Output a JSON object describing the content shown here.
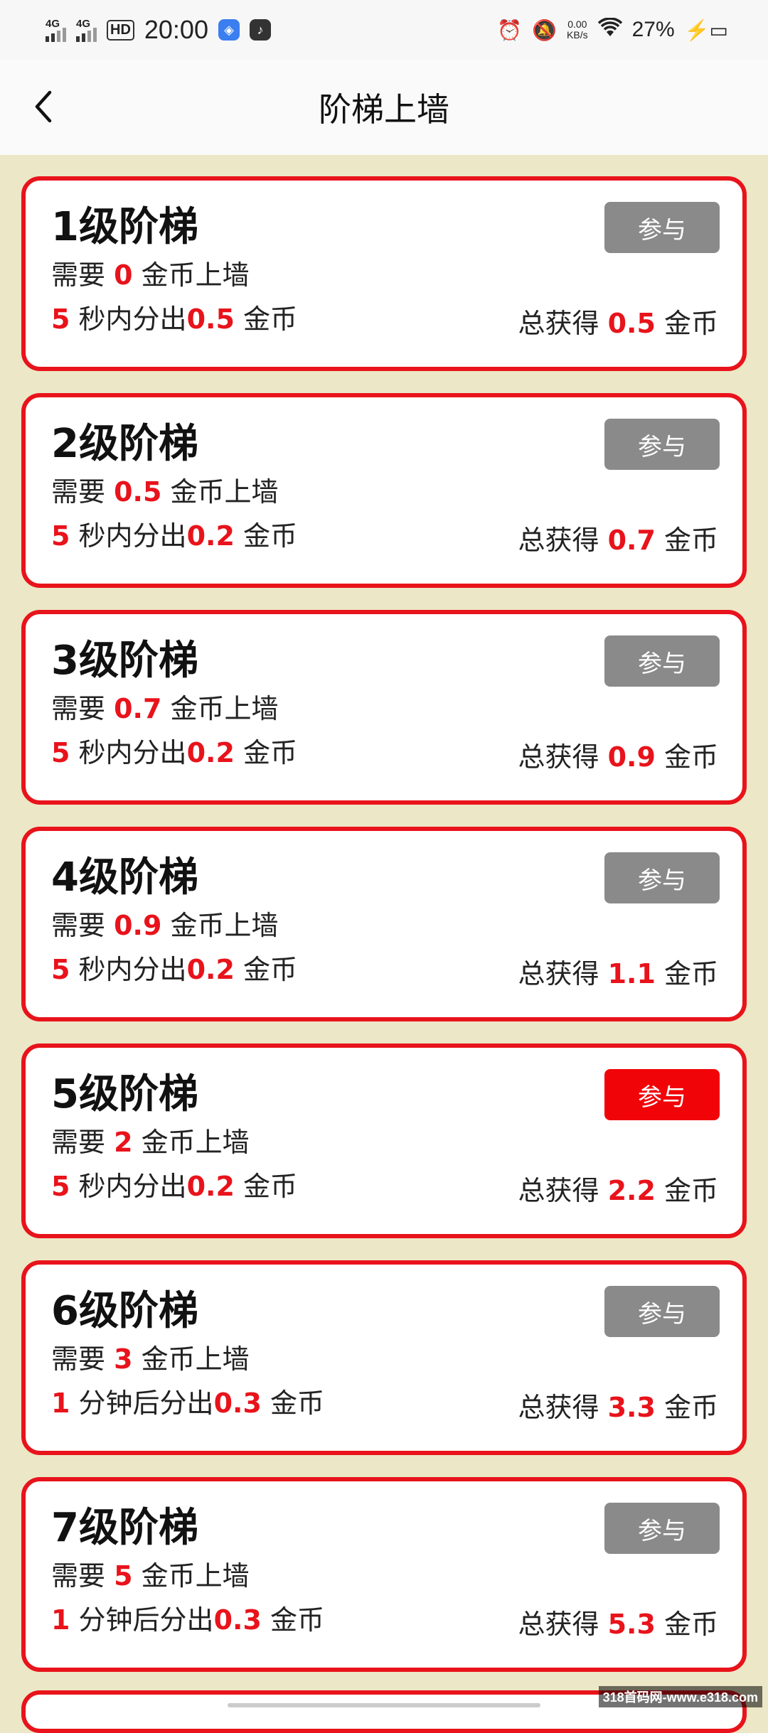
{
  "status": {
    "sim1": "4G",
    "sim2": "4G",
    "hd": "HD",
    "time": "20:00",
    "speed_value": "0.00",
    "speed_unit": "KB/s",
    "battery": "27%"
  },
  "header": {
    "title": "阶梯上墙"
  },
  "labels": {
    "need": "需要",
    "wall_suffix": "金币上墙",
    "coin": "金币",
    "total": "总获得",
    "join": "参与"
  },
  "levels": [
    {
      "name": "1级阶梯",
      "need": "0",
      "time_num": "5",
      "time_text": "秒内分出",
      "payout": "0.5",
      "total": "0.5",
      "active": false
    },
    {
      "name": "2级阶梯",
      "need": "0.5",
      "time_num": "5",
      "time_text": "秒内分出",
      "payout": "0.2",
      "total": "0.7",
      "active": false
    },
    {
      "name": "3级阶梯",
      "need": "0.7",
      "time_num": "5",
      "time_text": "秒内分出",
      "payout": "0.2",
      "total": "0.9",
      "active": false
    },
    {
      "name": "4级阶梯",
      "need": "0.9",
      "time_num": "5",
      "time_text": "秒内分出",
      "payout": "0.2",
      "total": "1.1",
      "active": false
    },
    {
      "name": "5级阶梯",
      "need": "2",
      "time_num": "5",
      "time_text": "秒内分出",
      "payout": "0.2",
      "total": "2.2",
      "active": true
    },
    {
      "name": "6级阶梯",
      "need": "3",
      "time_num": "1",
      "time_text": "分钟后分出",
      "payout": "0.3",
      "total": "3.3",
      "active": false
    },
    {
      "name": "7级阶梯",
      "need": "5",
      "time_num": "1",
      "time_text": "分钟后分出",
      "payout": "0.3",
      "total": "5.3",
      "active": false
    }
  ],
  "colors": {
    "accent": "#e8131b",
    "button_inactive": "#8a8a8a",
    "background": "#ece7c6"
  },
  "watermark": "318首码网-www.e318.com"
}
